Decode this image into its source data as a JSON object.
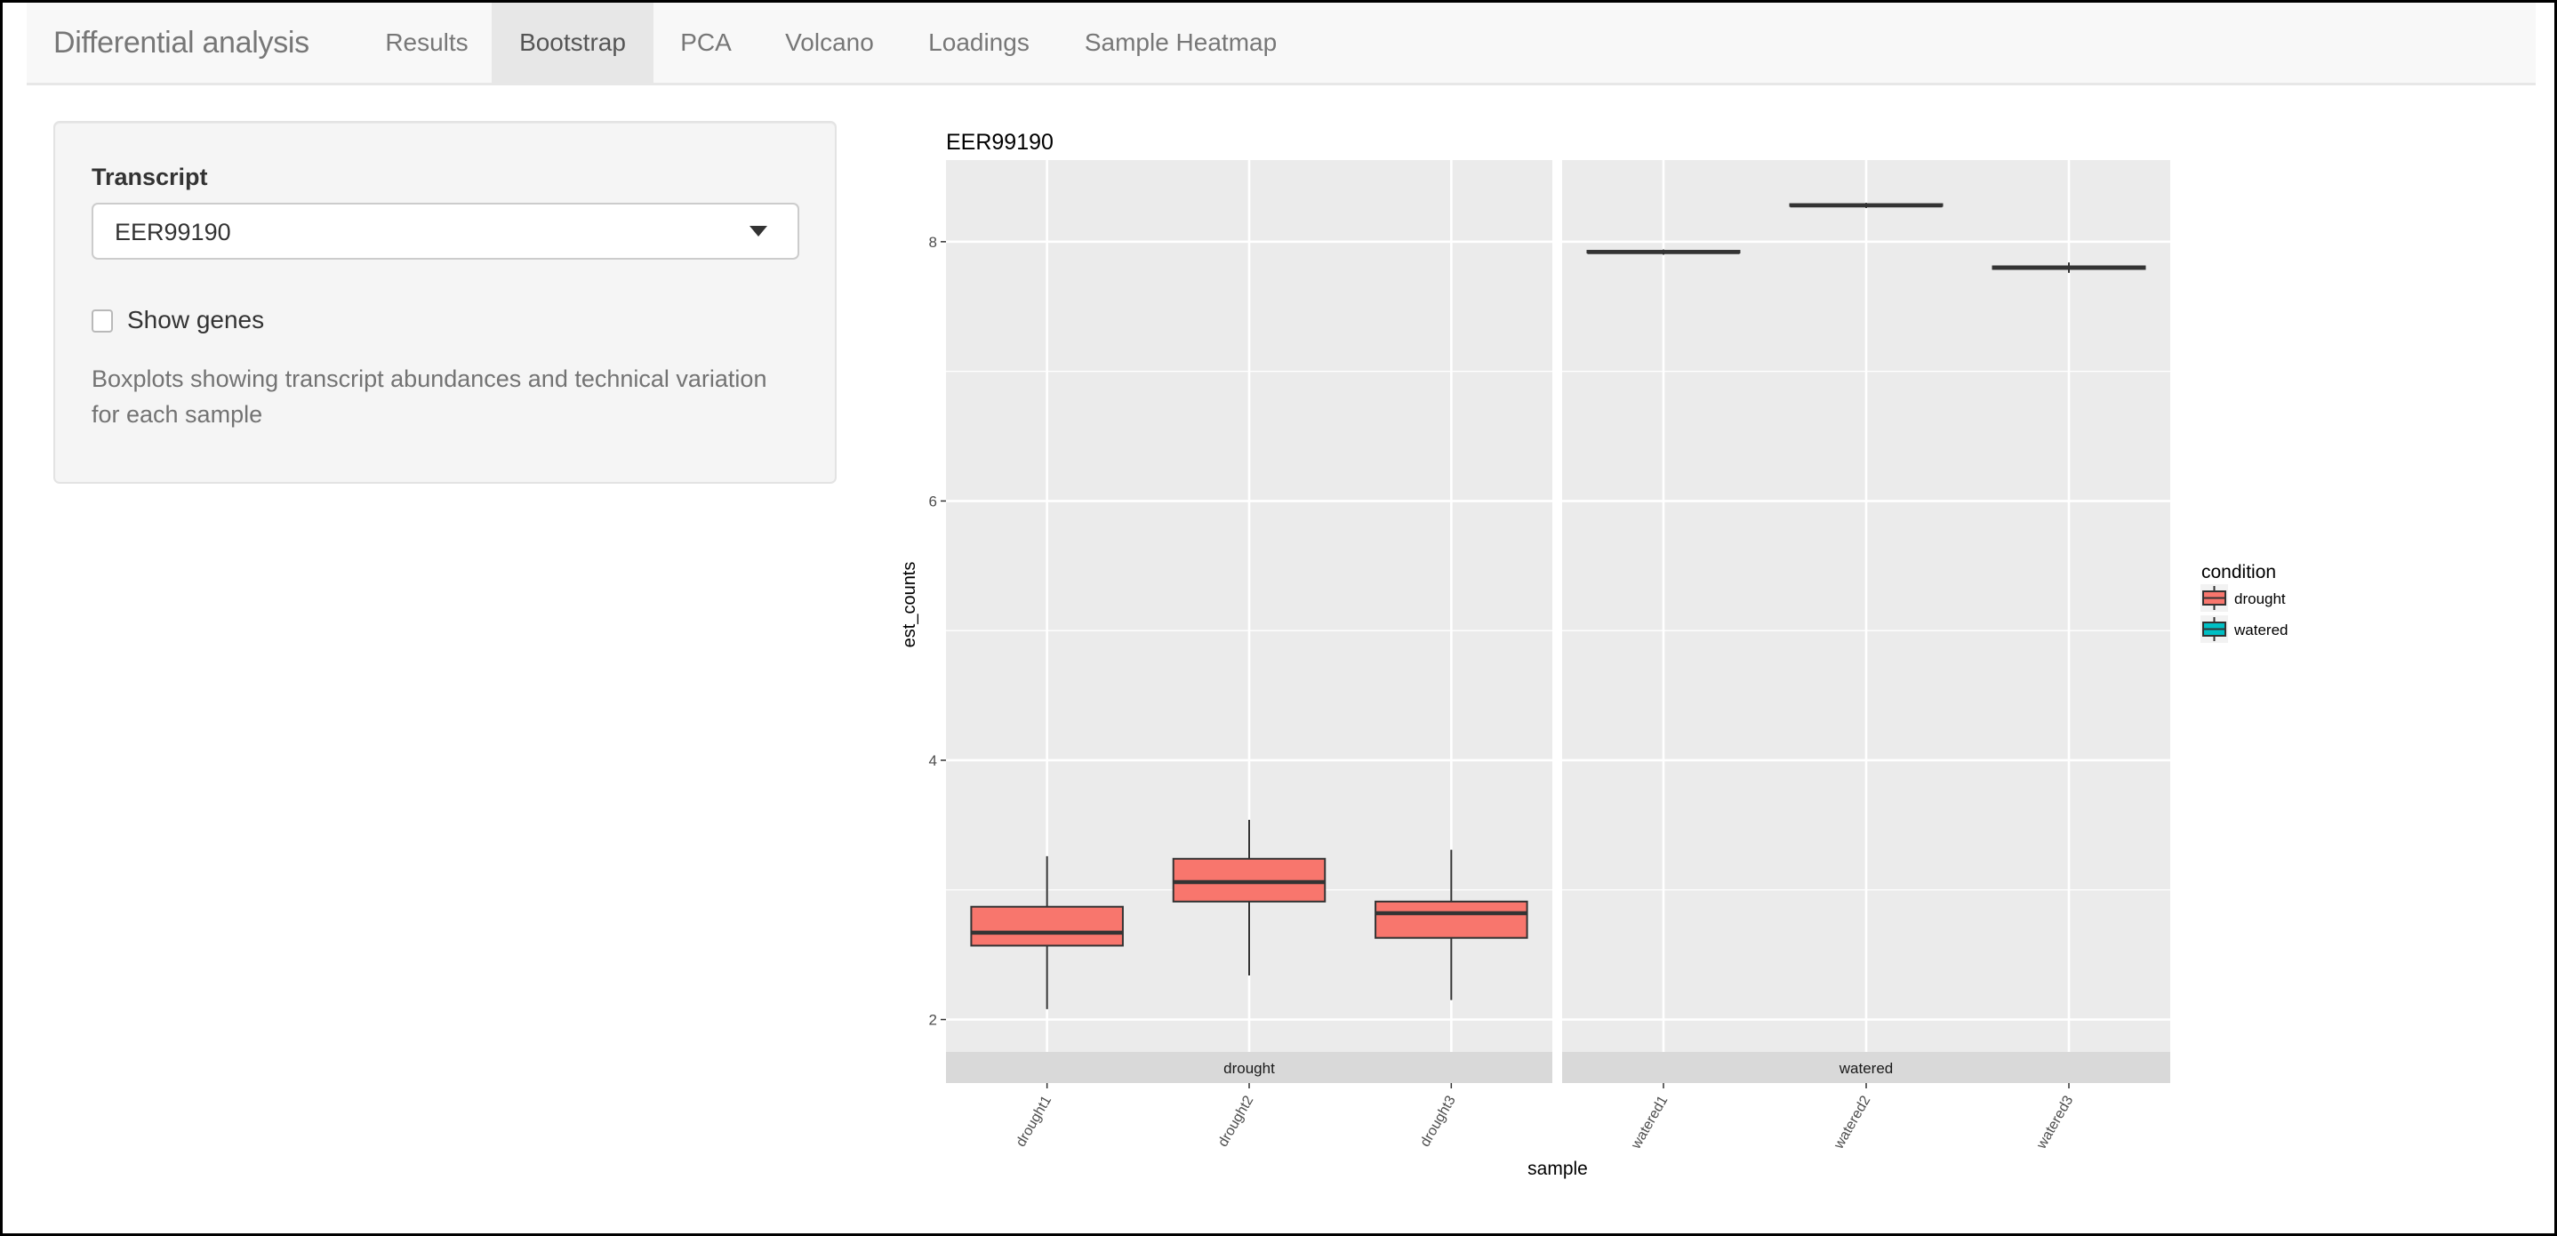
{
  "navbar": {
    "brand": "Differential analysis",
    "tabs": [
      {
        "label": "Results",
        "active": false
      },
      {
        "label": "Bootstrap",
        "active": true
      },
      {
        "label": "PCA",
        "active": false
      },
      {
        "label": "Volcano",
        "active": false
      },
      {
        "label": "Loadings",
        "active": false
      },
      {
        "label": "Sample Heatmap",
        "active": false
      }
    ]
  },
  "sidebar": {
    "transcript_label": "Transcript",
    "transcript_value": "EER99190",
    "dropdown_icon": "caret-down-icon",
    "show_genes_label": "Show genes",
    "show_genes_checked": false,
    "help_text": "Boxplots showing transcript abundances and technical variation for each sample"
  },
  "colors": {
    "drought": "#F8766D",
    "watered": "#00BFC4",
    "panel_bg": "#EBEBEB",
    "strip_bg": "#D9D9D9"
  },
  "chart_data": {
    "type": "boxplot",
    "title": "EER99190",
    "xlabel": "sample",
    "ylabel": "est_counts",
    "ylim": [
      1.75,
      8.63
    ],
    "yticks": [
      2,
      4,
      6,
      8
    ],
    "grid": true,
    "facets": [
      "drought",
      "watered"
    ],
    "legend": {
      "title": "condition",
      "placement": "right",
      "entries": [
        "drought",
        "watered"
      ]
    },
    "samples": [
      {
        "name": "drought1",
        "facet": "drought",
        "condition": "drought",
        "whisker_low": 2.08,
        "q1": 2.57,
        "median": 2.67,
        "q3": 2.87,
        "whisker_high": 3.26
      },
      {
        "name": "drought2",
        "facet": "drought",
        "condition": "drought",
        "whisker_low": 2.34,
        "q1": 2.91,
        "median": 3.06,
        "q3": 3.24,
        "whisker_high": 3.54
      },
      {
        "name": "drought3",
        "facet": "drought",
        "condition": "drought",
        "whisker_low": 2.15,
        "q1": 2.63,
        "median": 2.82,
        "q3": 2.91,
        "whisker_high": 3.31
      },
      {
        "name": "watered1",
        "facet": "watered",
        "condition": "watered",
        "whisker_low": 7.9,
        "q1": 7.92,
        "median": 7.92,
        "q3": 7.93,
        "whisker_high": 7.94
      },
      {
        "name": "watered2",
        "facet": "watered",
        "condition": "watered",
        "whisker_low": 8.26,
        "q1": 8.28,
        "median": 8.28,
        "q3": 8.29,
        "whisker_high": 8.3
      },
      {
        "name": "watered3",
        "facet": "watered",
        "condition": "watered",
        "whisker_low": 7.76,
        "q1": 7.79,
        "median": 7.8,
        "q3": 7.81,
        "whisker_high": 7.84
      }
    ]
  }
}
